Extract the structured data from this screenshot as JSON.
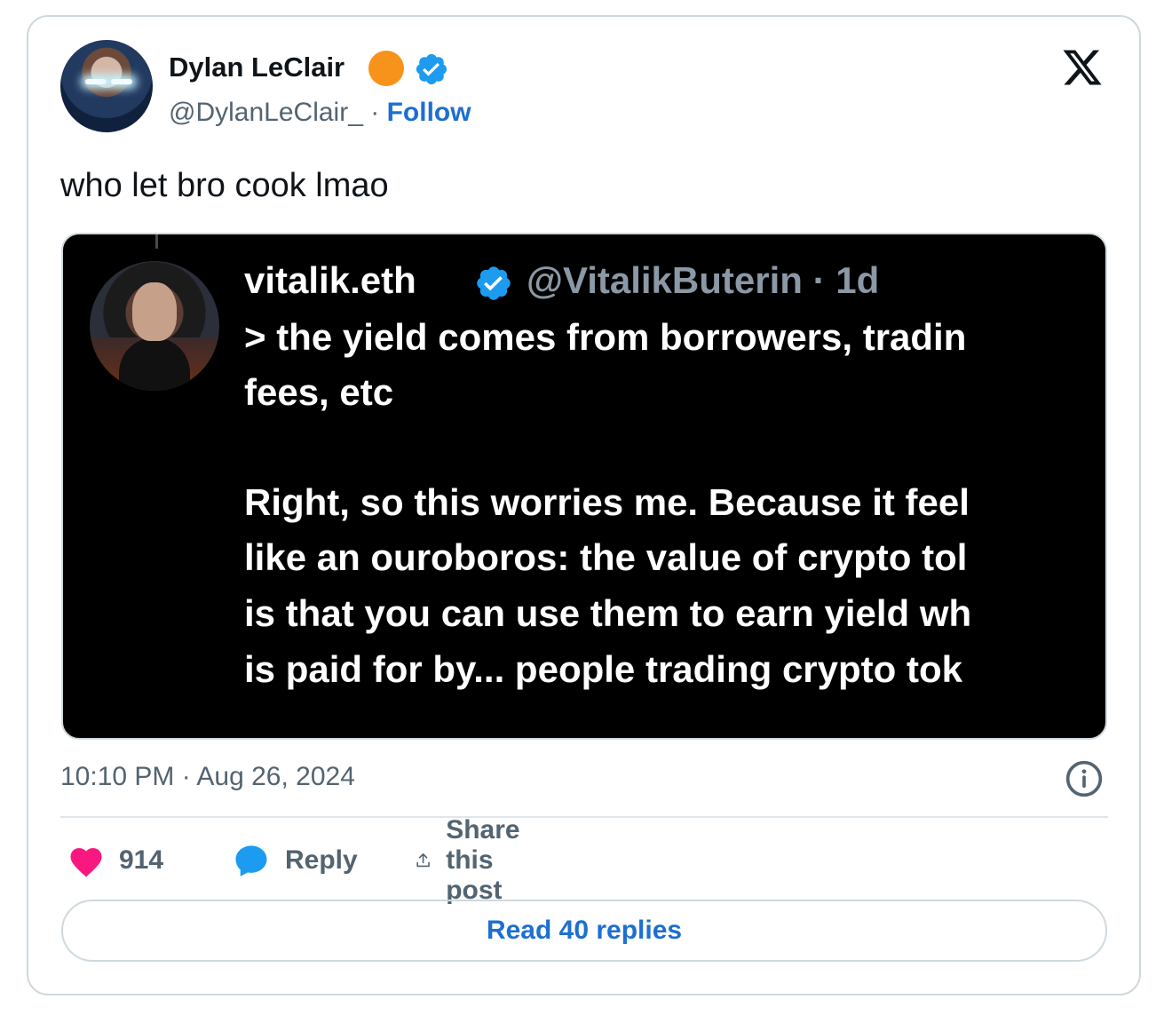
{
  "author": {
    "name": "Dylan LeClair",
    "handle": "@DylanLeClair_",
    "separator": "·",
    "follow_label": "Follow"
  },
  "tweet": {
    "text": "who let bro cook lmao"
  },
  "quoted": {
    "name": "vitalik.eth",
    "handle": "@VitalikButerin",
    "age": "· 1d",
    "lines": [
      "> the yield comes from borrowers, tradin",
      "fees, etc",
      "Right, so this worries me. Because it feel",
      "like an ouroboros: the value of crypto tol",
      "is that you can use them to earn yield wh",
      "is paid for by... people trading crypto tok"
    ]
  },
  "timestamp": "10:10 PM · Aug 26, 2024",
  "actions": {
    "likes": "914",
    "reply_label": "Reply",
    "share_label": "Share this post"
  },
  "read_replies": "Read 40 replies",
  "colors": {
    "accent": "#1d6fd1",
    "heart": "#f91880",
    "bubble": "#1d9bf0",
    "orange": "#f7931a"
  },
  "icons": [
    "verified-icon",
    "x-logo-icon",
    "info-icon",
    "heart-icon",
    "reply-icon",
    "share-icon"
  ]
}
